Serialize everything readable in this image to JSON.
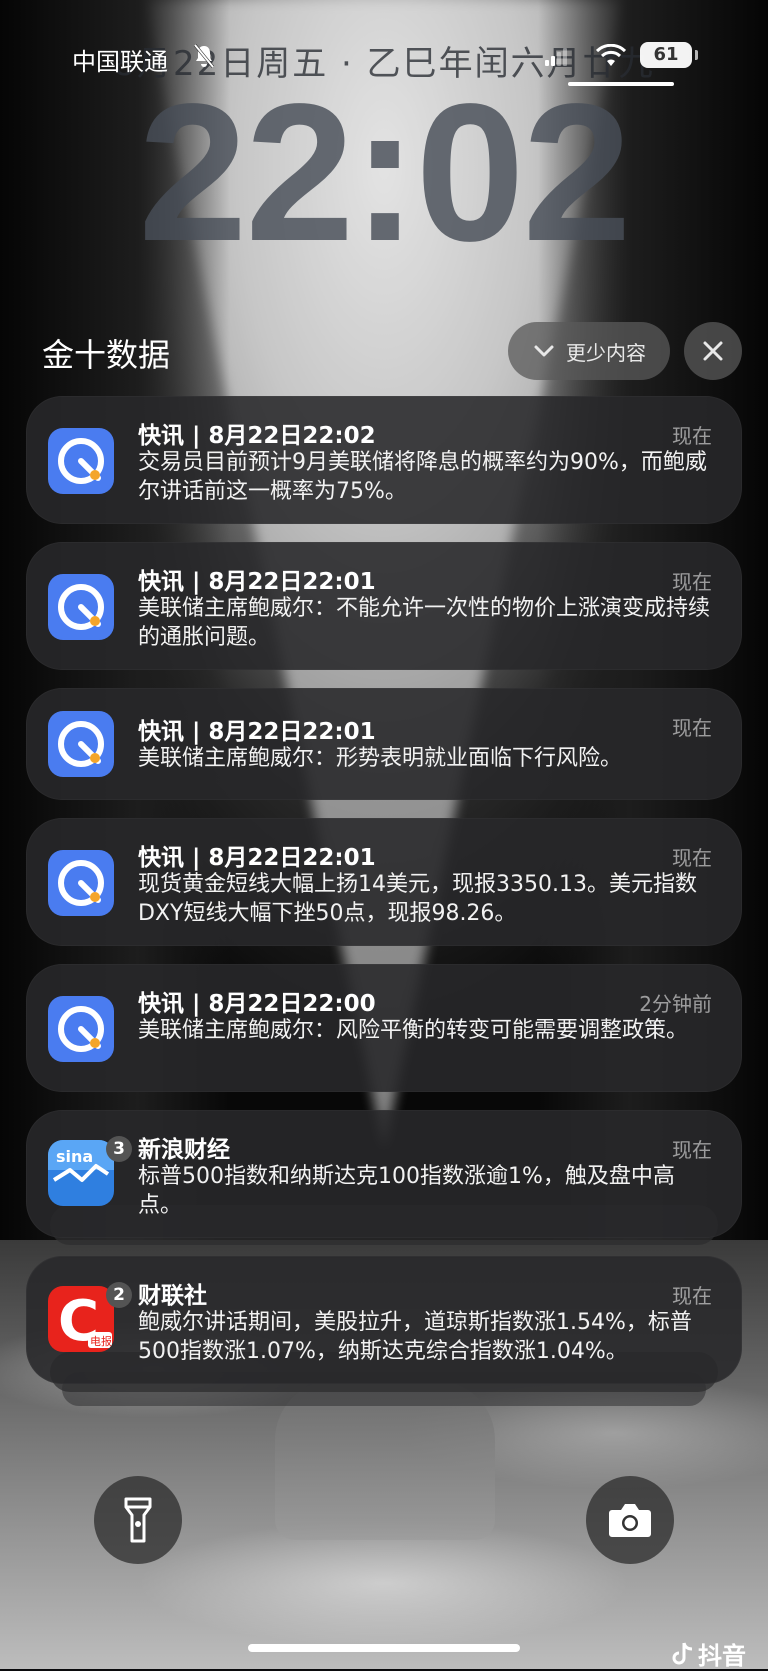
{
  "status_bar": {
    "carrier": "中国联通",
    "date_line": "8月22日周五 · 乙巳年闰六月廿九",
    "battery": "61"
  },
  "clock": {
    "time": "22:02"
  },
  "group": {
    "title": "金十数据",
    "show_less_label": "更少内容"
  },
  "notifications": [
    {
      "app": "jin10",
      "title": "快讯 | 8月22日22:02",
      "time": "现在",
      "body": "交易员目前预计9月美联储将降息的概率约为90%，而鲍威尔讲话前这一概率为75%。"
    },
    {
      "app": "jin10",
      "title": "快讯 | 8月22日22:01",
      "time": "现在",
      "body": "美联储主席鲍威尔：不能允许一次性的物价上涨演变成持续的通胀问题。"
    },
    {
      "app": "jin10",
      "title": "快讯 | 8月22日22:01",
      "time": "现在",
      "body": "美联储主席鲍威尔：形势表明就业面临下行风险。"
    },
    {
      "app": "jin10",
      "title": "快讯 | 8月22日22:01",
      "time": "现在",
      "body": "现货黄金短线大幅上扬14美元，现报3350.13。美元指数DXY短线大幅下挫50点，现报98.26。"
    },
    {
      "app": "jin10",
      "title": "快讯 | 8月22日22:00",
      "time": "2分钟前",
      "body": "美联储主席鲍威尔：风险平衡的转变可能需要调整政策。"
    },
    {
      "app": "sina",
      "title": "新浪财经",
      "time": "现在",
      "badge": "3",
      "body": "标普500指数和纳斯达克100指数涨逾1%，触及盘中高点。"
    },
    {
      "app": "cls",
      "title": "财联社",
      "time": "现在",
      "badge": "2",
      "body": "鲍威尔讲话期间，美股拉升，道琼斯指数涨1.54%，标普500指数涨1.07%，纳斯达克综合指数涨1.04%。"
    }
  ],
  "icons": {
    "jin10_bg": "#4a7cf0",
    "sina_bg": "#2f7fe0",
    "cls_bg": "#e8231c",
    "sina_text": "sina",
    "cls_letter": "C",
    "cls_tag": "电报"
  },
  "bottom": {
    "watermark": "抖音"
  }
}
